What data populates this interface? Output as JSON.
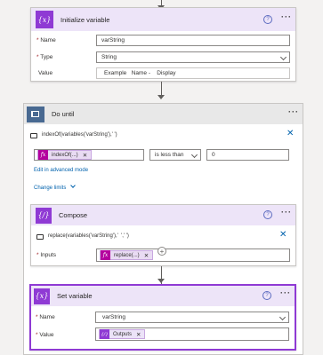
{
  "initialize_variable": {
    "title": "Initialize variable",
    "icon": "variable-icon",
    "name_label": "Name",
    "name_value": "varString",
    "type_label": "Type",
    "type_value": "String",
    "value_label": "Value",
    "value_text": "Example   Name -    Display"
  },
  "do_until": {
    "title": "Do until",
    "icon": "loop-icon",
    "condition_summary": "indexOf(variables('varString'),' ')",
    "token_label": "indexOf(...)",
    "operator": "is less than",
    "compare_value": "0",
    "advanced_link": "Edit in advanced mode",
    "limits_link": "Change limits"
  },
  "compose": {
    "title": "Compose",
    "icon": "compose-icon",
    "expression_summary": "replace(variables('varString'),'  ',' ')",
    "inputs_label": "Inputs",
    "token_label": "replace(...)"
  },
  "set_variable": {
    "title": "Set variable",
    "icon": "variable-icon",
    "name_label": "Name",
    "name_value": "varString",
    "value_label": "Value",
    "token_label": "Outputs"
  },
  "colors": {
    "accent_purple": "#8f3ad4",
    "link_blue": "#0062ad",
    "expression_magenta": "#b4009e"
  }
}
